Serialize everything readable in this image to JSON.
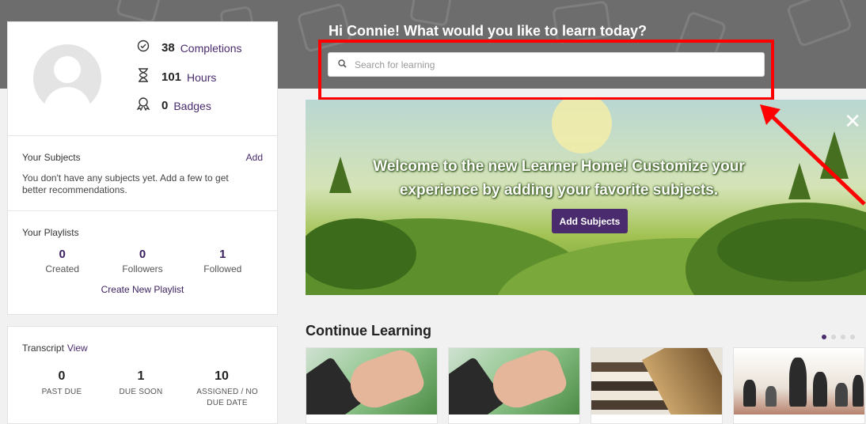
{
  "header": {
    "greeting": "Hi Connie! What would you like to learn today?",
    "search_placeholder": "Search for learning"
  },
  "profile": {
    "completions": {
      "value": "38",
      "label": "Completions",
      "icon": "check-circle-icon"
    },
    "hours": {
      "value": "101",
      "label": "Hours",
      "icon": "hourglass-icon"
    },
    "badges": {
      "value": "0",
      "label": "Badges",
      "icon": "badge-icon"
    }
  },
  "subjects": {
    "title": "Your Subjects",
    "add_label": "Add",
    "empty_text": "You don't have any subjects yet. Add a few to get better recommendations."
  },
  "playlists": {
    "title": "Your Playlists",
    "stats": [
      {
        "value": "0",
        "label": "Created"
      },
      {
        "value": "0",
        "label": "Followers"
      },
      {
        "value": "1",
        "label": "Followed"
      }
    ],
    "create_label": "Create New Playlist"
  },
  "transcript": {
    "title": "Transcript",
    "view_label": "View",
    "stats": [
      {
        "value": "0",
        "label": "PAST DUE"
      },
      {
        "value": "1",
        "label": "DUE SOON"
      },
      {
        "value": "10",
        "label": "ASSIGNED / NO DUE DATE"
      }
    ]
  },
  "banner": {
    "line1": "Welcome to the new Learner Home! Customize your",
    "line2": "experience by adding your favorite subjects.",
    "button_label": "Add Subjects",
    "close_glyph": "✕"
  },
  "continue_learning": {
    "title": "Continue Learning",
    "carousel_pages": 4,
    "active_page": 1,
    "courses": [
      {
        "image": "tablet-hand"
      },
      {
        "image": "tablet-hand"
      },
      {
        "image": "books"
      },
      {
        "image": "chess"
      }
    ]
  },
  "colors": {
    "brand_purple": "#4a2c6e",
    "highlight_red": "#ff0000",
    "header_gray": "#6d6d6d"
  }
}
